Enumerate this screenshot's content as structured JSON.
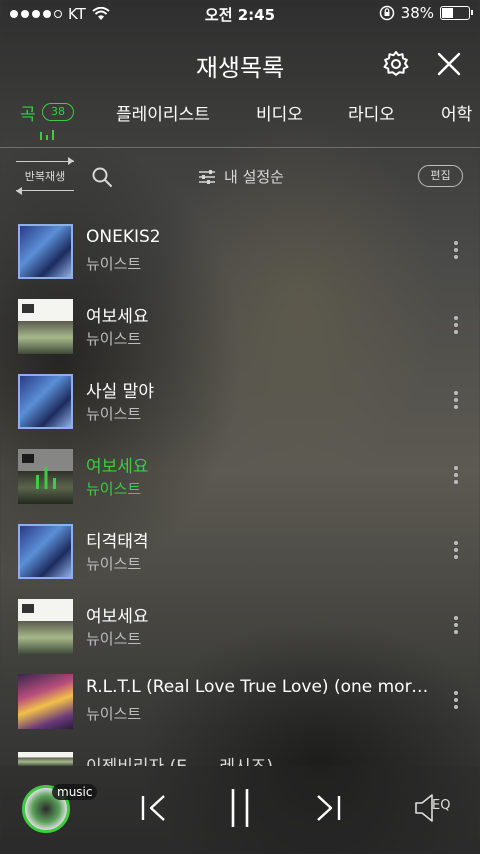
{
  "status_bar": {
    "carrier": "KT",
    "time": "오전 2:45",
    "battery": "38%",
    "battery_level": 0.38
  },
  "header": {
    "title": "재생목록",
    "settings_icon": "gear-icon",
    "close_icon": "close-icon"
  },
  "tabs": [
    {
      "label": "곡",
      "count": "38",
      "active": true
    },
    {
      "label": "플레이리스트"
    },
    {
      "label": "비디오"
    },
    {
      "label": "라디오"
    },
    {
      "label": "어학"
    }
  ],
  "toolbar": {
    "repeat_label": "반복재생",
    "sort_label": "내 설정순",
    "edit_label": "편집"
  },
  "songs": [
    {
      "title": "ONEKIS2",
      "artist": "뉴이스트",
      "art": "a1"
    },
    {
      "title": "여보세요",
      "artist": "뉴이스트",
      "art": "a2"
    },
    {
      "title": "사실 말야",
      "artist": "뉴이스트",
      "art": "a1"
    },
    {
      "title": "여보세요",
      "artist": "뉴이스트",
      "art": "a2",
      "playing": true
    },
    {
      "title": "티격태격",
      "artist": "뉴이스트",
      "art": "a1"
    },
    {
      "title": "여보세요",
      "artist": "뉴이스트",
      "art": "a2"
    },
    {
      "title": "R.L.T.L (Real Love True Love) (one morn...",
      "artist": "뉴이스트",
      "art": "a3"
    }
  ],
  "peek_song": {
    "title": "이젠비리자 (E..... 레시즈)"
  },
  "player": {
    "music_label": "music",
    "eq_label": "EQ"
  },
  "colors": {
    "accent": "#3fcb43"
  }
}
